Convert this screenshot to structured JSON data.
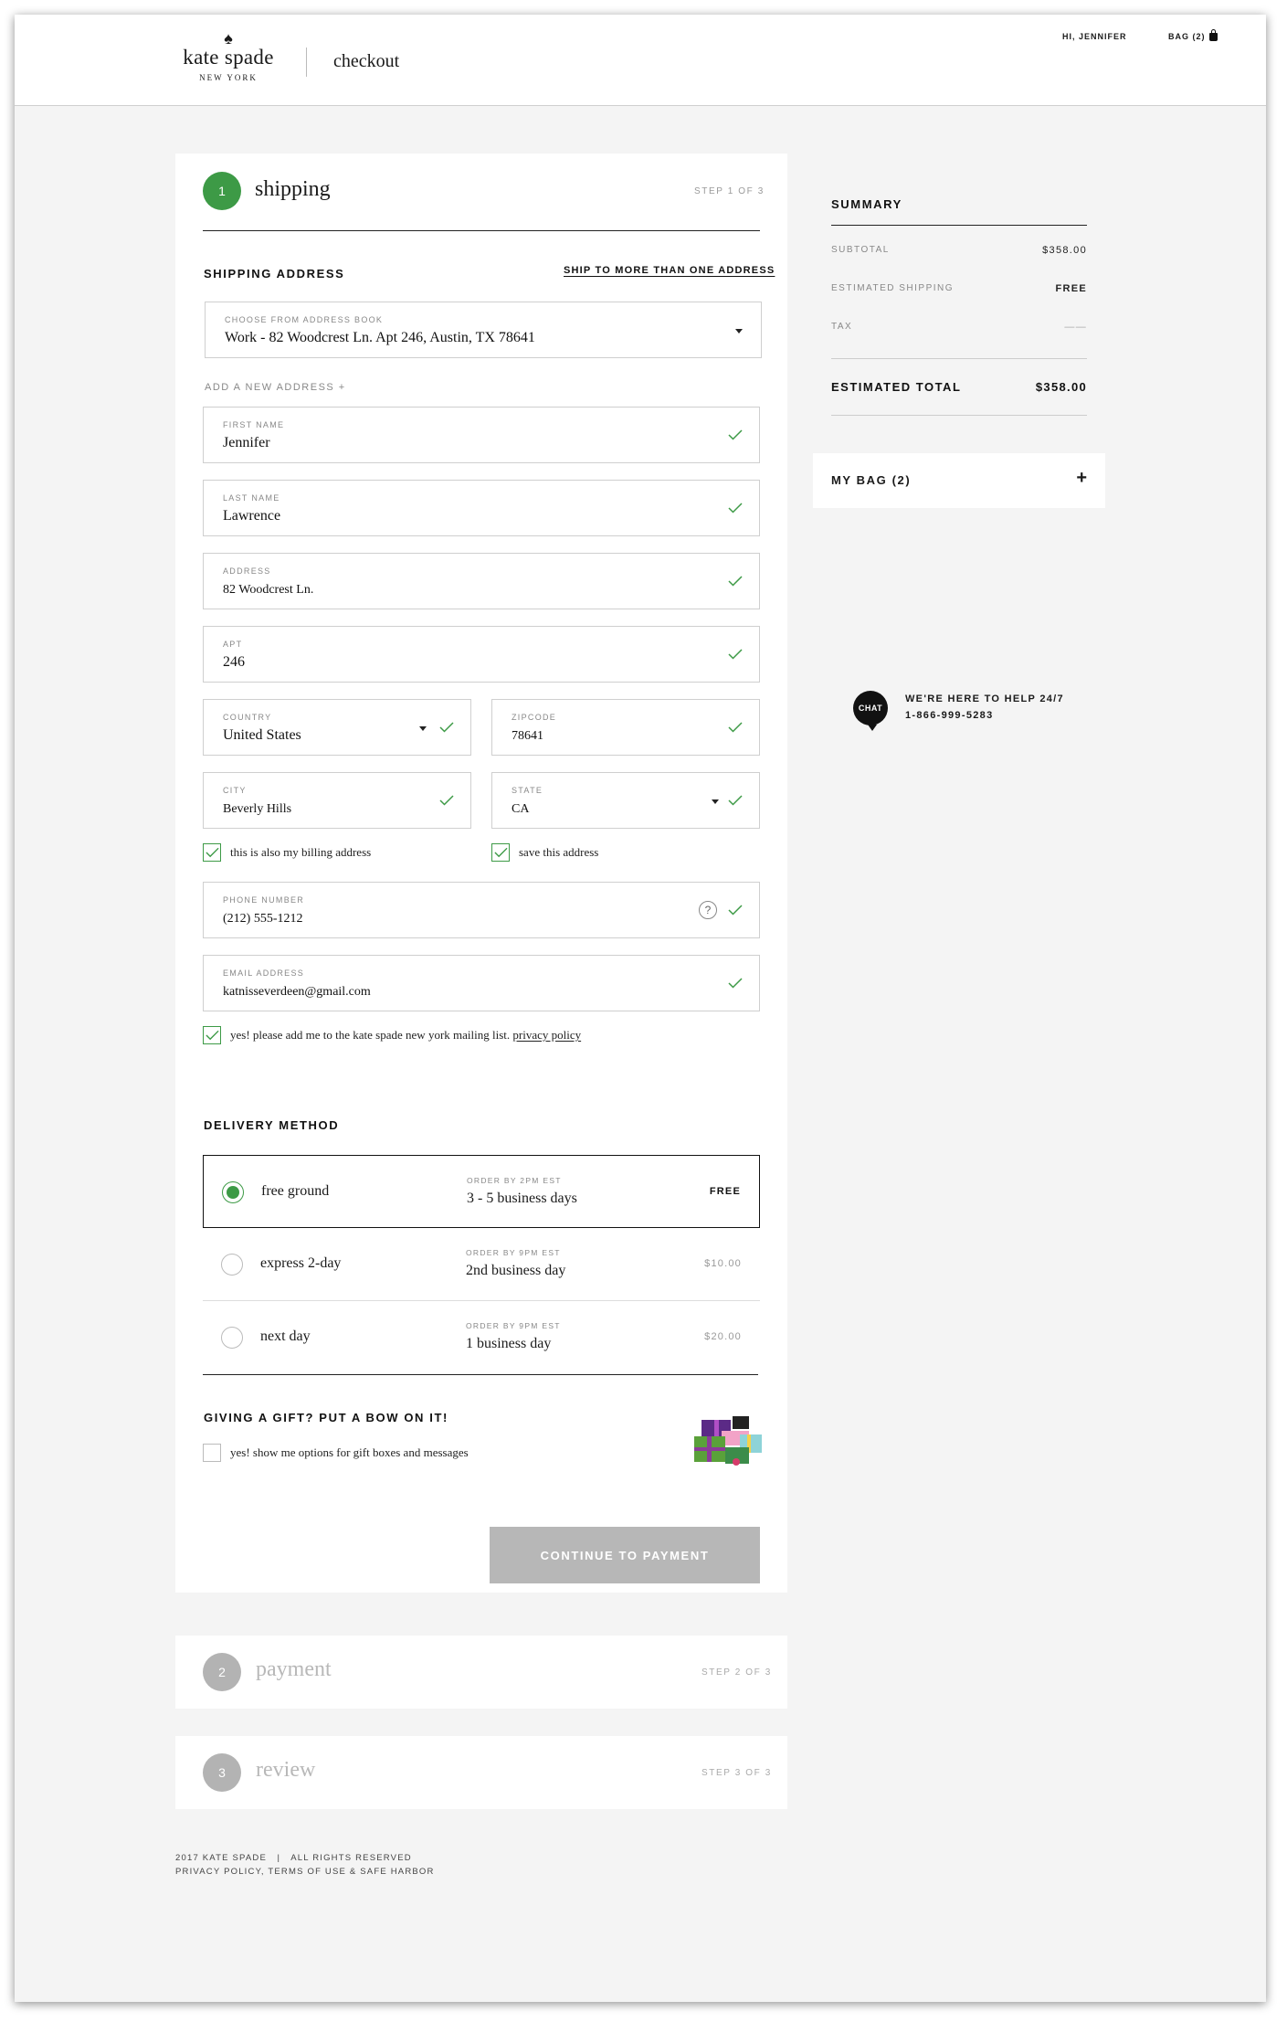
{
  "header": {
    "brand": "kate spade",
    "brand_sub": "NEW YORK",
    "section_title": "checkout",
    "greeting": "HI, JENNIFER",
    "bag_link": "BAG (2)",
    "bag_icon": "shopping-bag-icon"
  },
  "shipping": {
    "step_number": "1",
    "step_title": "shipping",
    "step_count": "STEP 1 OF 3",
    "address_heading": "SHIPPING ADDRESS",
    "ship_multiple_link": "SHIP TO MORE THAN ONE ADDRESS",
    "address_book": {
      "label": "CHOOSE FROM ADDRESS BOOK",
      "value": "Work - 82 Woodcrest Ln. Apt 246, Austin, TX 78641"
    },
    "add_new_address": "ADD A NEW ADDRESS +",
    "first_name": {
      "label": "FIRST NAME",
      "value": "Jennifer"
    },
    "last_name": {
      "label": "LAST NAME",
      "value": "Lawrence"
    },
    "address": {
      "label": "ADDRESS",
      "value": "82 Woodcrest Ln."
    },
    "apt": {
      "label": "APT",
      "value": "246"
    },
    "country": {
      "label": "COUNTRY",
      "value": "United States"
    },
    "zipcode": {
      "label": "ZIPCODE",
      "value": "78641"
    },
    "city": {
      "label": "CITY",
      "value": "Beverly Hills"
    },
    "state": {
      "label": "STATE",
      "value": "CA"
    },
    "billing_checkbox": "this is also my billing address",
    "save_checkbox": "save this address",
    "phone": {
      "label": "PHONE NUMBER",
      "value": "(212) 555-1212",
      "help": "?"
    },
    "email": {
      "label": "EMAIL ADDRESS",
      "value": "katnisseverdeen@gmail.com"
    },
    "mailing_list": "yes! please add me to the kate spade new york mailing list.",
    "privacy_link": "privacy policy"
  },
  "delivery": {
    "heading": "DELIVERY METHOD",
    "options": [
      {
        "name": "free ground",
        "order_by": "ORDER BY 2PM EST",
        "time": "3 - 5 business days",
        "price": "FREE",
        "selected": true
      },
      {
        "name": "express 2-day",
        "order_by": "ORDER BY 9PM EST",
        "time": "2nd business day",
        "price": "$10.00",
        "selected": false
      },
      {
        "name": "next day",
        "order_by": "ORDER BY 9PM EST",
        "time": "1 business day",
        "price": "$20.00",
        "selected": false
      }
    ]
  },
  "gift": {
    "heading": "GIVING A GIFT? PUT A BOW ON IT!",
    "checkbox": "yes! show me options for gift boxes and messages"
  },
  "continue_button": "CONTINUE TO PAYMENT",
  "payment_step": {
    "number": "2",
    "title": "payment",
    "count": "STEP 2 OF 3"
  },
  "review_step": {
    "number": "3",
    "title": "review",
    "count": "STEP 3 OF 3"
  },
  "summary": {
    "heading": "SUMMARY",
    "subtotal_label": "SUBTOTAL",
    "subtotal_value": "$358.00",
    "shipping_label": "ESTIMATED SHIPPING",
    "shipping_value": "FREE",
    "tax_label": "TAX",
    "tax_value": "——",
    "total_label": "ESTIMATED TOTAL",
    "total_value": "$358.00"
  },
  "my_bag": {
    "label": "MY BAG (2)",
    "toggle": "+"
  },
  "chat": {
    "bubble": "CHAT",
    "line1": "WE'RE HERE TO HELP 24/7",
    "line2": "1-866-999-5283"
  },
  "footer": {
    "line1": "2017 KATE SPADE   |   ALL RIGHTS RESERVED",
    "line2": "PRIVACY POLICY, TERMS OF USE & SAFE HARBOR"
  },
  "colors": {
    "accent_green": "#3d9a46",
    "disabled_button": "#b7b7b7",
    "background": "#f4f4f4"
  }
}
